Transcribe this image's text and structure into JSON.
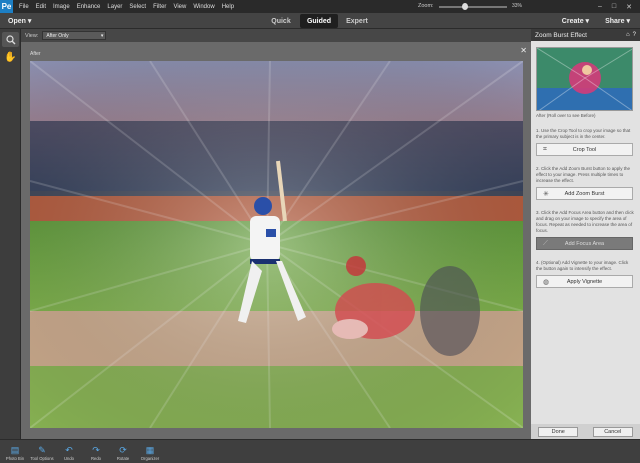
{
  "menubar": {
    "logo": "Pe",
    "items": [
      "File",
      "Edit",
      "Image",
      "Enhance",
      "Layer",
      "Select",
      "Filter",
      "View",
      "Window",
      "Help"
    ],
    "controls": [
      "–",
      "□",
      "✕"
    ]
  },
  "modebar": {
    "open_label": "Open",
    "modes": [
      "Quick",
      "Guided",
      "Expert"
    ],
    "active_mode": "Guided",
    "create_label": "Create",
    "share_label": "Share"
  },
  "viewbar": {
    "view_label": "View:",
    "view_value": "After Only",
    "zoom_label": "Zoom:",
    "zoom_value": "33%",
    "zoom_fraction": 0.33
  },
  "canvas": {
    "after_label": "After"
  },
  "panel": {
    "title": "Zoom Burst Effect",
    "thumb_caption": "After (Roll over to see Before)",
    "steps": [
      {
        "text": "1. Use the Crop Tool to crop your image so that the primary subject is in the center.",
        "button": "Crop Tool",
        "icon": "crop-icon"
      },
      {
        "text": "2. Click the Add Zoom Burst button to apply the effect to your image. Press multiple times to increase the effect.",
        "button": "Add Zoom Burst",
        "icon": "burst-icon"
      },
      {
        "text": "3. Click the Add Focus Area button and then click and drag on your image to specify the area of focus. Repeat as needed to increase the area of focus.",
        "button": "Add Focus Area",
        "icon": "focus-icon"
      },
      {
        "text": "4. (Optional) Add Vignette to your image. Click the button again to intensify the effect.",
        "button": "Apply Vignette",
        "icon": "vignette-icon"
      }
    ],
    "done_label": "Done",
    "cancel_label": "Cancel"
  },
  "bottombar": {
    "items": [
      {
        "label": "Photo Bin",
        "icon": "photo-bin-icon"
      },
      {
        "label": "Tool Options",
        "icon": "tool-options-icon"
      },
      {
        "label": "Undo",
        "icon": "undo-icon"
      },
      {
        "label": "Redo",
        "icon": "redo-icon"
      },
      {
        "label": "Rotate",
        "icon": "rotate-icon"
      },
      {
        "label": "Organizer",
        "icon": "organizer-icon"
      }
    ]
  }
}
